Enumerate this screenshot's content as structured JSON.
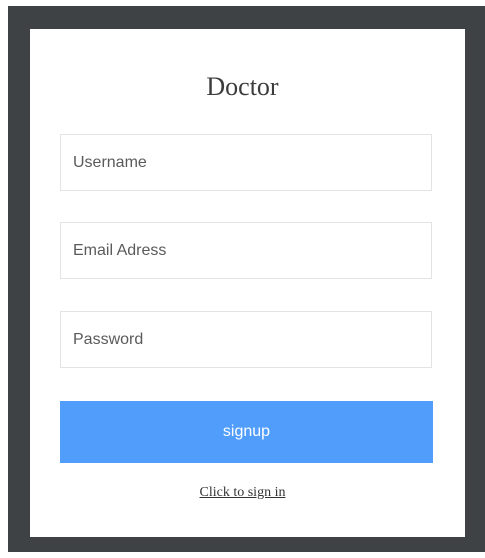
{
  "form": {
    "title": "Doctor",
    "username_placeholder": "Username",
    "email_placeholder": "Email Adress",
    "password_placeholder": "Password",
    "submit_label": "signup",
    "signin_link": "Click to sign in"
  },
  "colors": {
    "frame": "#3e4245",
    "button": "#519dfc",
    "card": "#ffffff"
  }
}
